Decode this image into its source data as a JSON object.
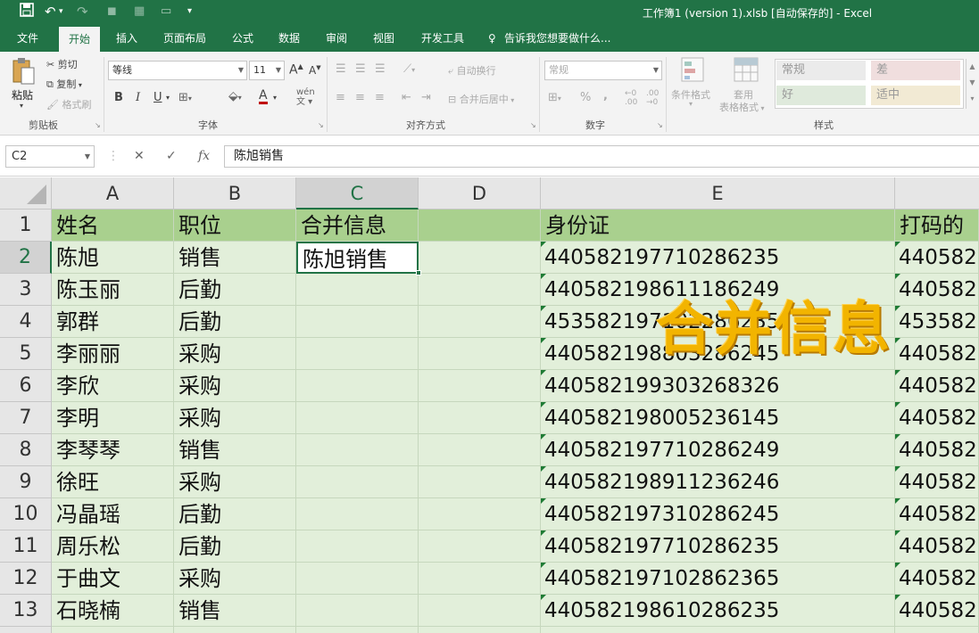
{
  "titlebar": {
    "title": "工作簿1 (version 1).xlsb [自动保存的] - Excel",
    "save_icon": "save-icon",
    "undo_icon": "undo-icon",
    "redo_icon": "redo-icon"
  },
  "tabs": [
    "文件",
    "开始",
    "插入",
    "页面布局",
    "公式",
    "数据",
    "审阅",
    "视图",
    "开发工具"
  ],
  "tell_me": "告诉我您想要做什么...",
  "ribbon": {
    "clipboard": {
      "paste": "粘贴",
      "cut": "剪切",
      "copy": "复制",
      "format_painter": "格式刷",
      "label": "剪贴板"
    },
    "font": {
      "name": "等线",
      "size": "11",
      "grow": "A",
      "shrink": "A",
      "bold": "B",
      "italic": "I",
      "underline": "U",
      "label": "字体"
    },
    "alignment": {
      "wrap": "自动换行",
      "merge": "合并后居中",
      "label": "对齐方式"
    },
    "number": {
      "format": "常规",
      "percent": "%",
      "comma": ",",
      "label": "数字"
    },
    "styles": {
      "conditional": "条件格式",
      "table_format_1": "套用",
      "table_format_2": "表格格式",
      "normal": "常规",
      "bad": "差",
      "good": "好",
      "neutral": "适中",
      "label": "样式"
    }
  },
  "formula_bar": {
    "name_box": "C2",
    "cancel": "✕",
    "enter": "✓",
    "fx": "fx",
    "content": "陈旭销售"
  },
  "columns": [
    "A",
    "B",
    "C",
    "D",
    "E",
    ""
  ],
  "rows": [
    "1",
    "2",
    "3",
    "4",
    "5",
    "6",
    "7",
    "8",
    "9",
    "10",
    "11",
    "12",
    "13"
  ],
  "sheet": {
    "headers": {
      "a": "姓名",
      "b": "职位",
      "c": "合并信息",
      "e": "身份证",
      "f": "打码的"
    },
    "data": [
      {
        "name": "陈旭",
        "role": "销售",
        "merged": "陈旭销售",
        "id": "440582197710286235",
        "masked": "440582"
      },
      {
        "name": "陈玉丽",
        "role": "后勤",
        "merged": "",
        "id": "440582198611186249",
        "masked": "440582"
      },
      {
        "name": "郭群",
        "role": "后勤",
        "merged": "",
        "id": "453582197102286235",
        "masked": "453582"
      },
      {
        "name": "李丽丽",
        "role": "采购",
        "merged": "",
        "id": "440582198803286245",
        "masked": "440582"
      },
      {
        "name": "李欣",
        "role": "采购",
        "merged": "",
        "id": "440582199303268326",
        "masked": "440582"
      },
      {
        "name": "李明",
        "role": "采购",
        "merged": "",
        "id": "440582198005236145",
        "masked": "440582"
      },
      {
        "name": "李琴琴",
        "role": "销售",
        "merged": "",
        "id": "440582197710286249",
        "masked": "440582"
      },
      {
        "name": "徐旺",
        "role": "采购",
        "merged": "",
        "id": "440582198911236246",
        "masked": "440582"
      },
      {
        "name": "冯晶瑶",
        "role": "后勤",
        "merged": "",
        "id": "440582197310286245",
        "masked": "440582"
      },
      {
        "name": "周乐松",
        "role": "后勤",
        "merged": "",
        "id": "440582197710286235",
        "masked": "440582"
      },
      {
        "name": "于曲文",
        "role": "采购",
        "merged": "",
        "id": "440582197102862365",
        "masked": "440582"
      },
      {
        "name": "石晓楠",
        "role": "销售",
        "merged": "",
        "id": "440582198610286235",
        "masked": "440582"
      }
    ]
  },
  "overlay_text": "合并信息",
  "colors": {
    "brand": "#217346",
    "header_fill": "#a9d08e",
    "cell_fill": "#e2efda",
    "overlay": "#f2b400"
  }
}
